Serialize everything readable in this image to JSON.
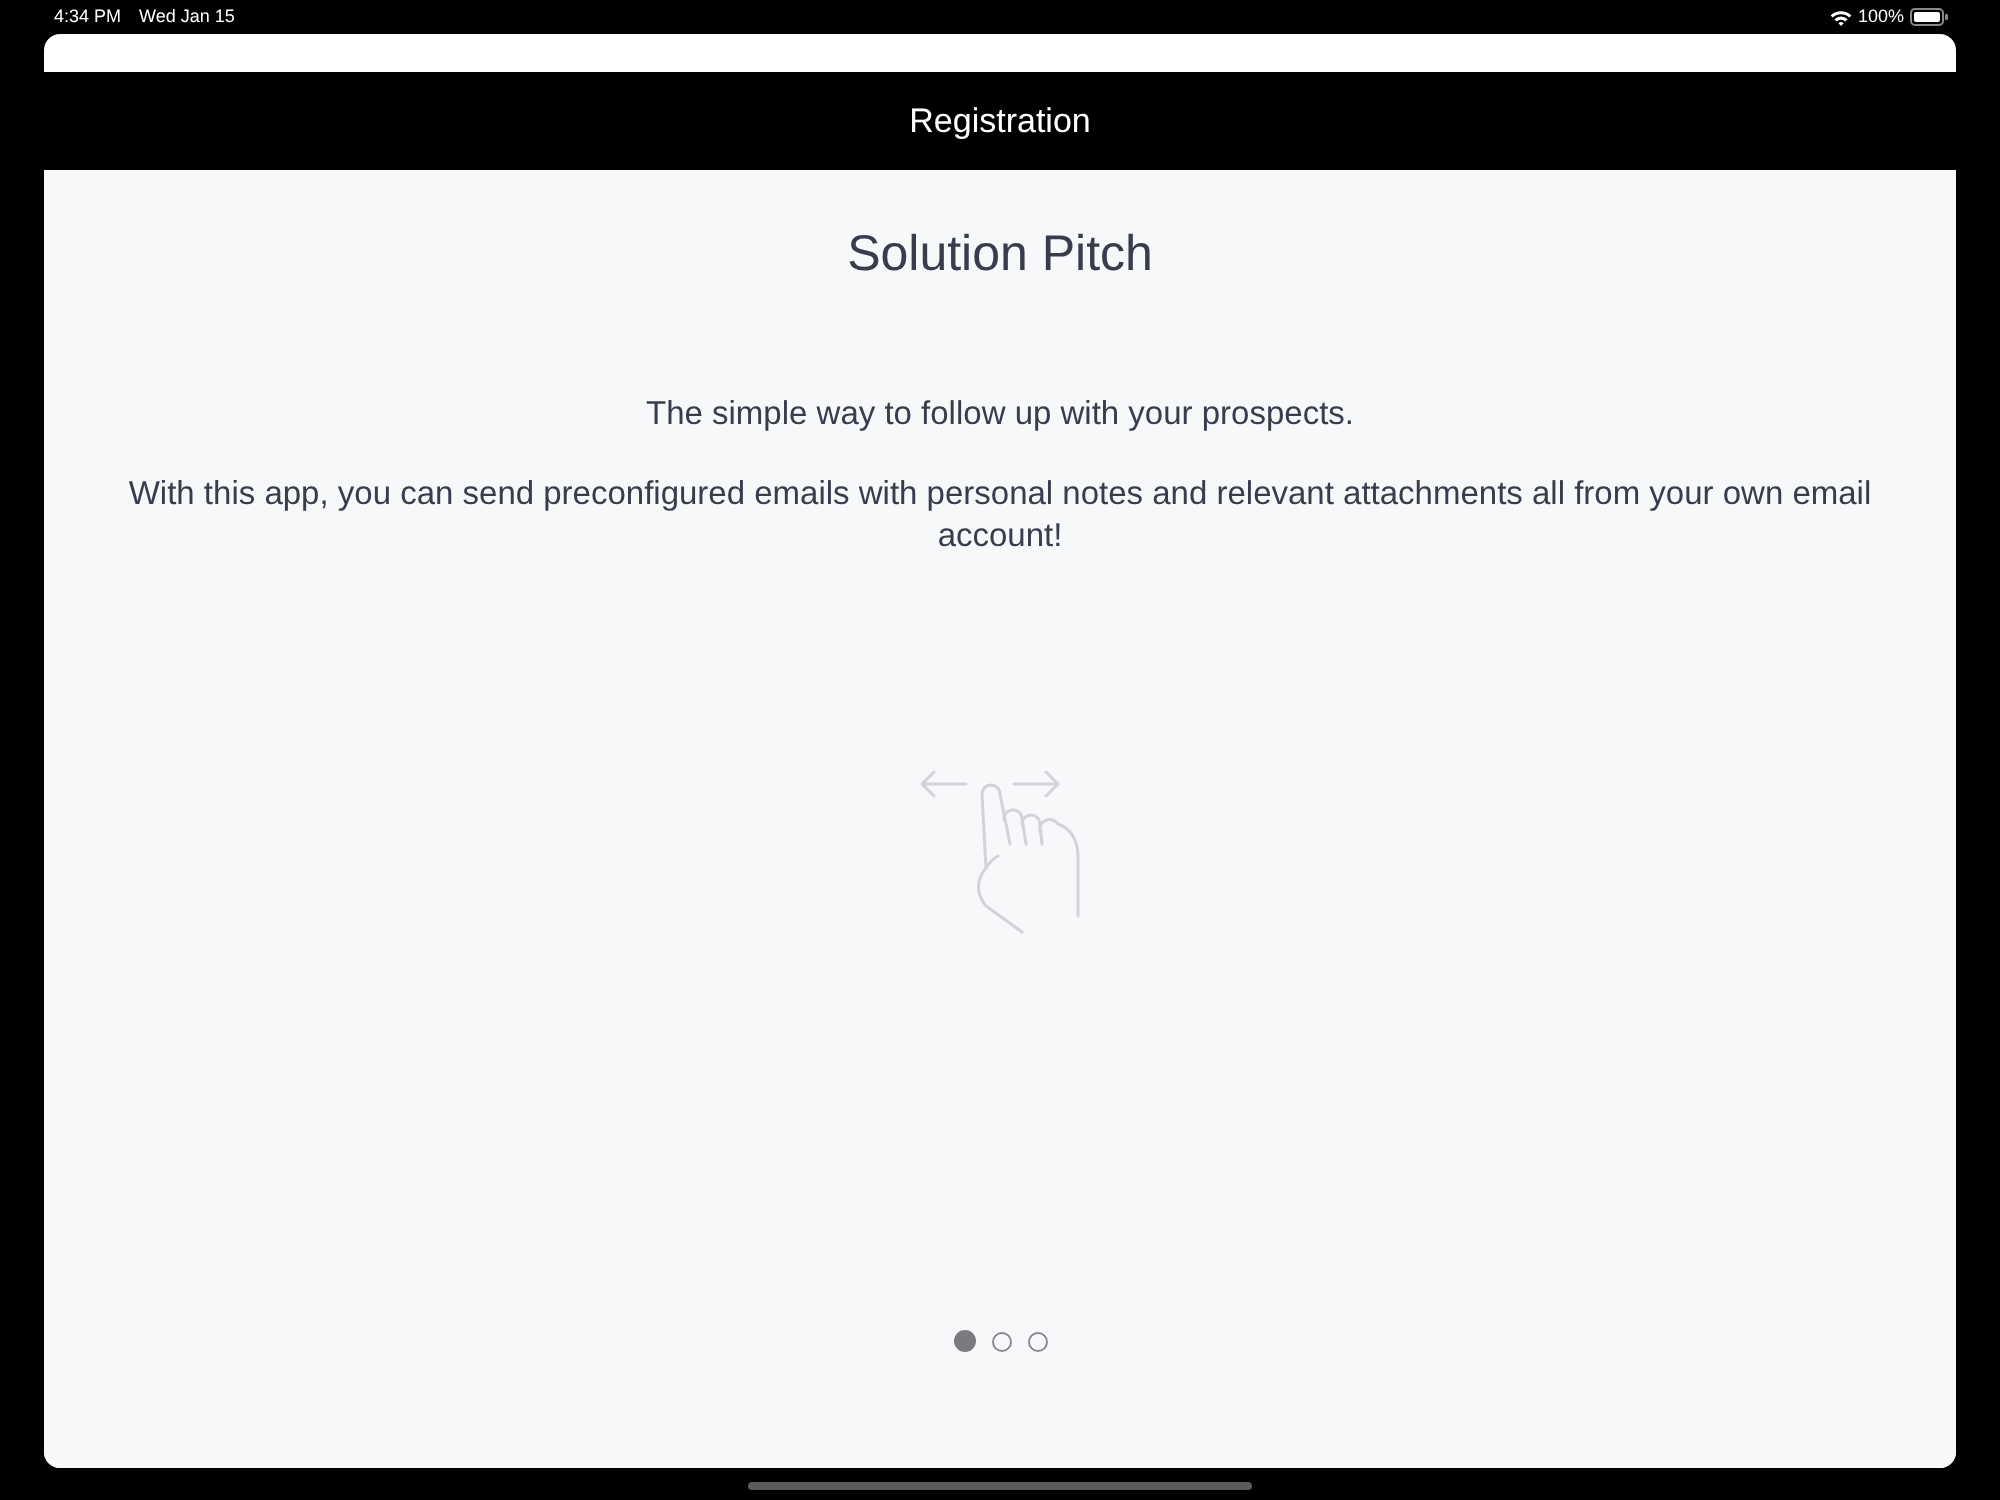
{
  "status_bar": {
    "time": "4:34 PM",
    "date": "Wed Jan 15",
    "battery": "100%"
  },
  "nav_bar": {
    "title": "Registration"
  },
  "page": {
    "title": "Solution Pitch",
    "paragraphs": [
      "The simple way to follow up with your prospects.",
      "With this app, you can send preconfigured emails with personal notes and relevant attachments all from your own email account!"
    ]
  },
  "pager": {
    "dots": [
      {
        "selected": true
      },
      {
        "selected": false
      },
      {
        "selected": false
      }
    ]
  }
}
